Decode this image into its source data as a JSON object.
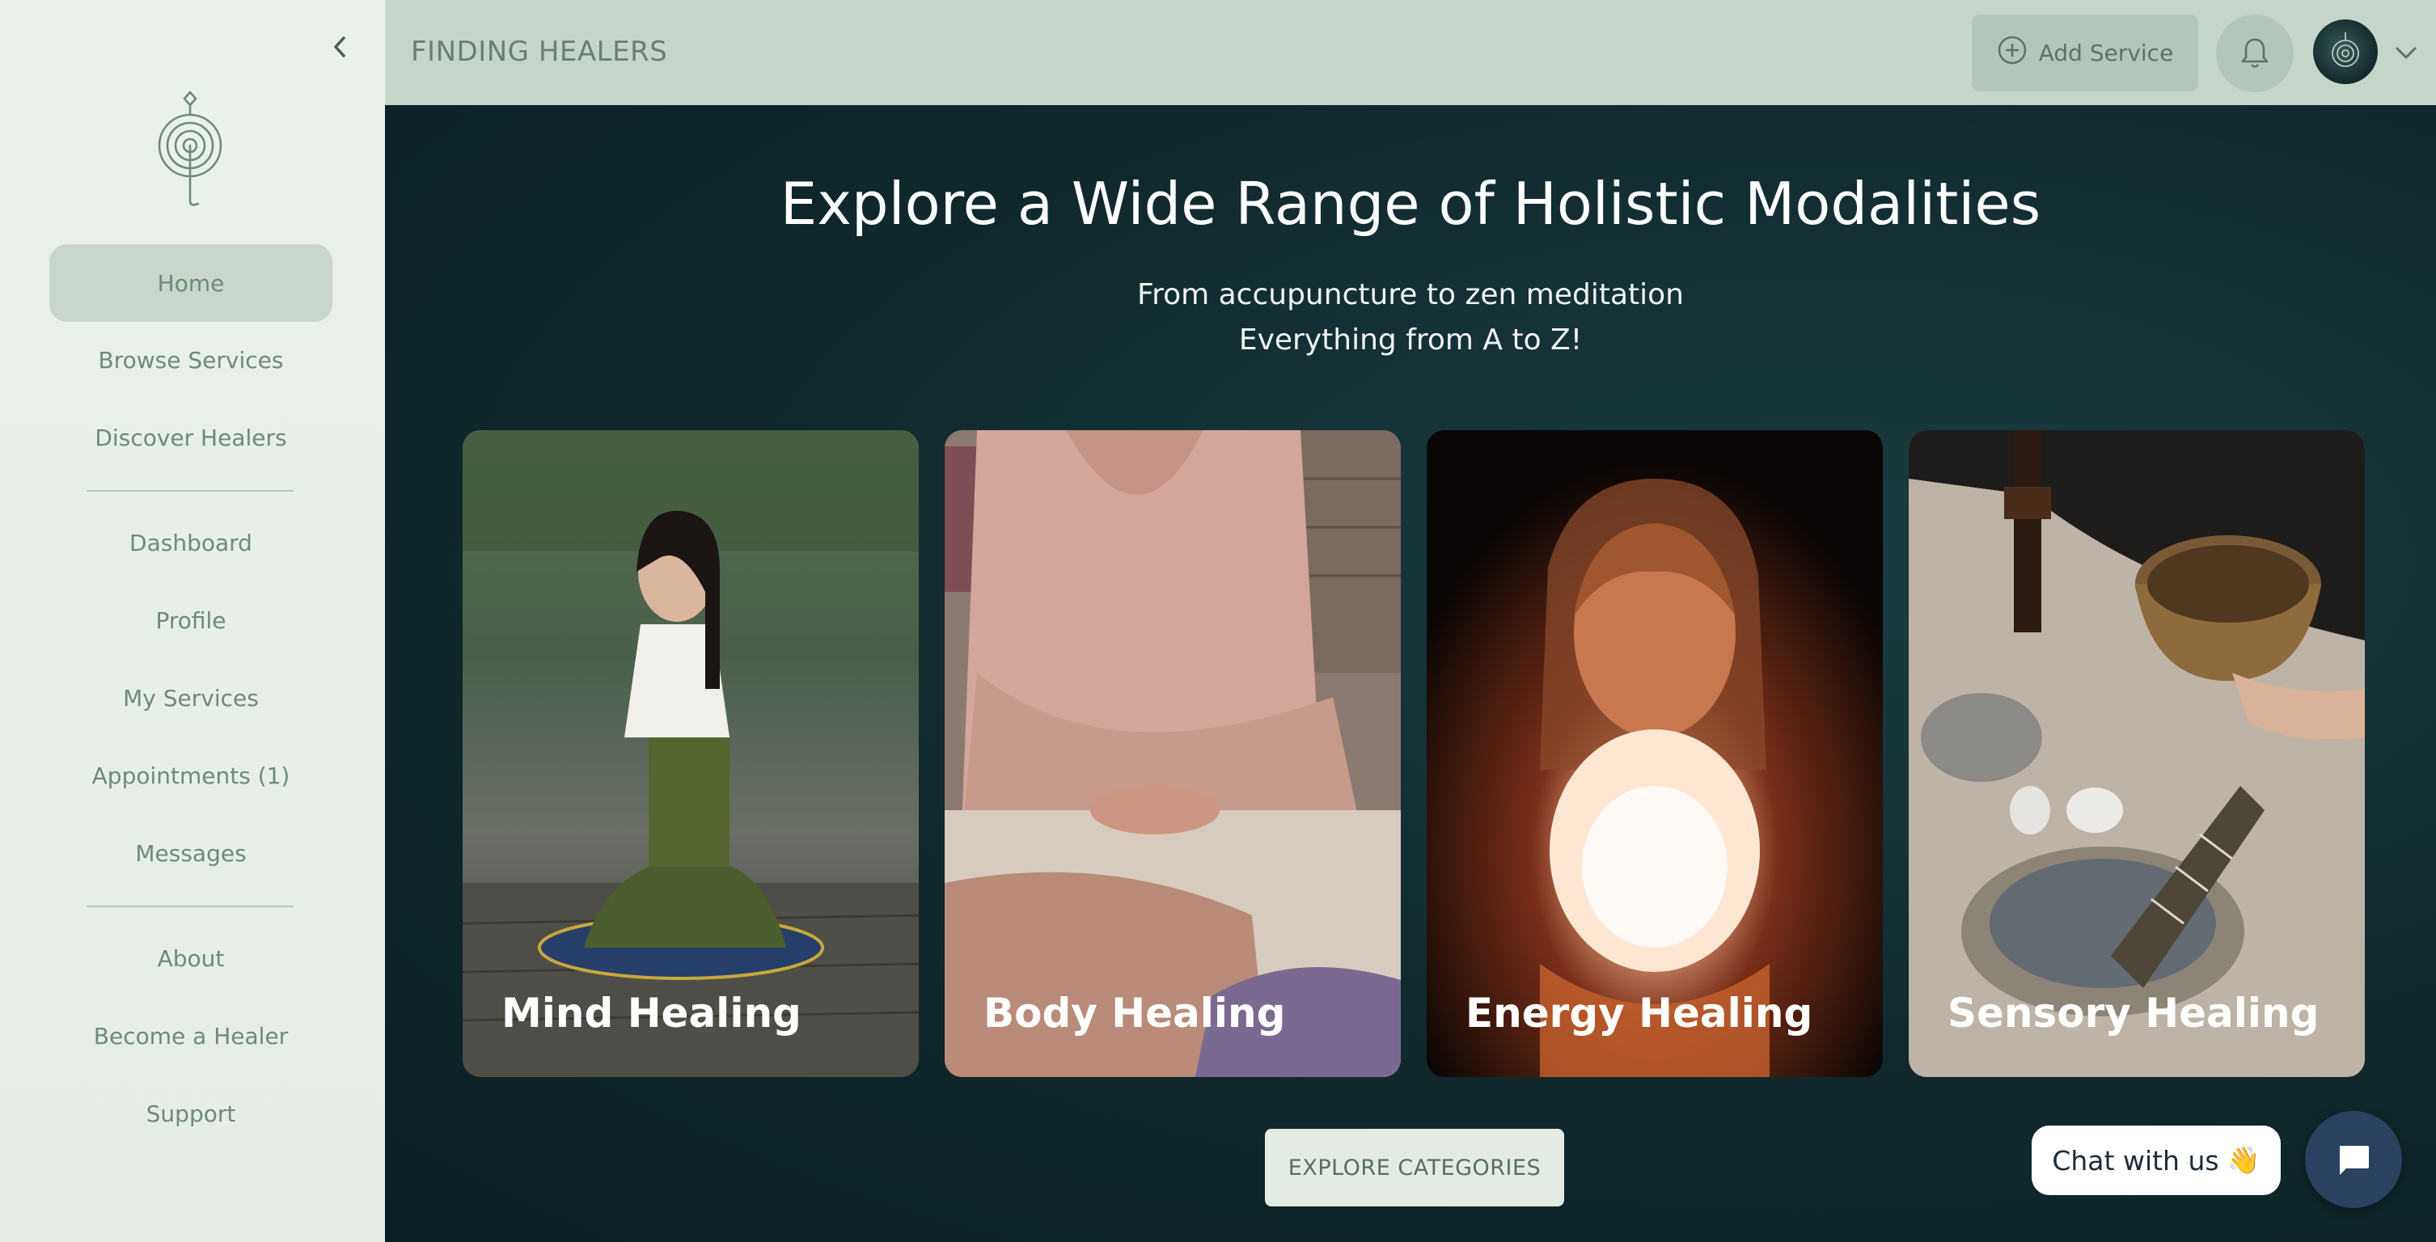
{
  "sidebar": {
    "collapse_icon": "chevron-left-icon",
    "logo_icon": "spiral-logo-icon",
    "items": [
      {
        "label": "Home",
        "active": true
      },
      {
        "label": "Browse Services"
      },
      {
        "label": "Discover Healers"
      },
      {
        "label": "Dashboard"
      },
      {
        "label": "Profile"
      },
      {
        "label": "My Services"
      },
      {
        "label": "Appointments (1)"
      },
      {
        "label": "Messages"
      },
      {
        "label": "About"
      },
      {
        "label": "Become a Healer"
      },
      {
        "label": "Support"
      }
    ]
  },
  "topbar": {
    "brand": "FINDING HEALERS",
    "add_service_label": "Add Service",
    "add_service_icon": "plus-circle-icon",
    "bell_icon": "bell-icon",
    "avatar_icon": "avatar",
    "menu_icon": "chevron-down-icon"
  },
  "hero": {
    "title": "Explore a Wide Range of Holistic Modalities",
    "subtitle_line1": "From accupuncture to zen meditation",
    "subtitle_line2": "Everything from A to Z!"
  },
  "cards": [
    {
      "label": "Mind Healing"
    },
    {
      "label": "Body Healing"
    },
    {
      "label": "Energy Healing"
    },
    {
      "label": "Sensory Healing"
    }
  ],
  "explore_button": "EXPLORE CATEGORIES",
  "chat": {
    "bubble_label": "Chat with us",
    "bubble_emoji": "👋",
    "chat_icon": "chat-icon"
  },
  "colors": {
    "sidebar_bg": "#eaf0ea",
    "topbar_bg": "#c6d5ca",
    "main_bg": "#10282c",
    "accent_text": "#6f8a78",
    "chat_button": "#2a4260"
  }
}
